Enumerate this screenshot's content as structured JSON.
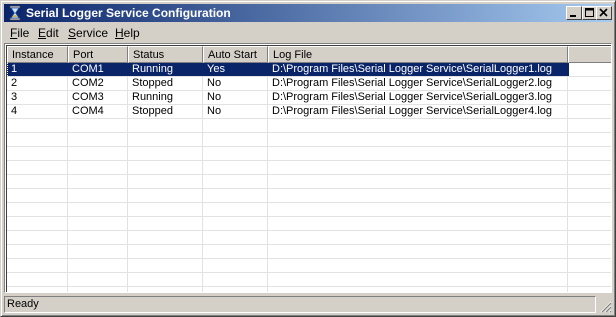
{
  "window": {
    "title": "Serial Logger Service Configuration"
  },
  "menu": [
    {
      "key": "F",
      "rest": "ile"
    },
    {
      "key": "E",
      "rest": "dit"
    },
    {
      "key": "S",
      "rest": "ervice"
    },
    {
      "key": "H",
      "rest": "elp"
    }
  ],
  "columns": [
    "Instance",
    "Port",
    "Status",
    "Auto Start",
    "Log File"
  ],
  "rows": [
    [
      "1",
      "COM1",
      "Running",
      "Yes",
      "D:\\Program Files\\Serial Logger Service\\SerialLogger1.log"
    ],
    [
      "2",
      "COM2",
      "Stopped",
      "No",
      "D:\\Program Files\\Serial Logger Service\\SerialLogger2.log"
    ],
    [
      "3",
      "COM3",
      "Running",
      "No",
      "D:\\Program Files\\Serial Logger Service\\SerialLogger3.log"
    ],
    [
      "4",
      "COM4",
      "Stopped",
      "No",
      "D:\\Program Files\\Serial Logger Service\\SerialLogger4.log"
    ]
  ],
  "selected_row": 0,
  "status": "Ready",
  "colors": {
    "title_start": "#0a246a",
    "title_end": "#a6caf0",
    "selection": "#0a246a",
    "face": "#d4d0c8"
  }
}
